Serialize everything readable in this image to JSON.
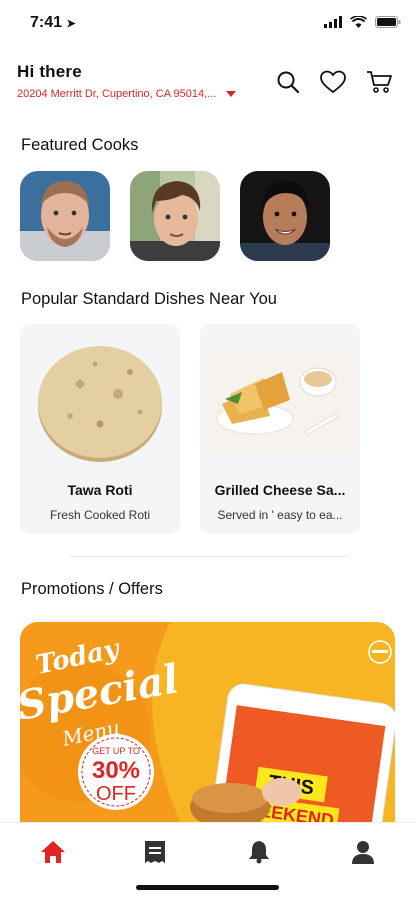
{
  "status_bar": {
    "time": "7:41"
  },
  "header": {
    "greeting": "Hi there",
    "address": "20204 Merritt Dr, Cupertino, CA  95014,..."
  },
  "sections": {
    "featured_cooks": "Featured Cooks",
    "popular_dishes": "Popular Standard Dishes Near You",
    "promotions": "Promotions / Offers"
  },
  "dishes": [
    {
      "name": "Tawa Roti",
      "description": "Fresh Cooked Roti"
    },
    {
      "name": "Grilled Cheese Sa...",
      "description": "Served in ' easy to ea..."
    }
  ],
  "promo": {
    "line1": "Today",
    "line2": "Special",
    "line3": "Menu",
    "badge_top": "GET UP TO",
    "badge_value": "30%",
    "badge_bottom": "OFF",
    "phone_text1": "THIS",
    "phone_text2": "WEEKEND"
  },
  "colors": {
    "accent": "#e02424",
    "promo_orange": "#f7a21b"
  },
  "tabs": [
    "home-icon",
    "receipt-icon",
    "bell-icon",
    "user-icon"
  ]
}
